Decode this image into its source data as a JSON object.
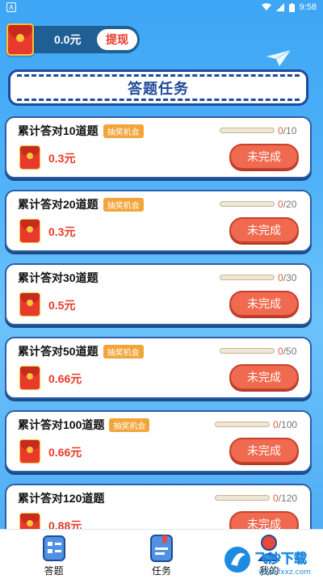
{
  "status": {
    "time": "9:58"
  },
  "wallet": {
    "balance": "0.0元",
    "withdraw_label": "提现"
  },
  "banner": {
    "title": "答题任务"
  },
  "badge_label": "抽奖机会",
  "button_label": "未完成",
  "tasks": [
    {
      "title": "累计答对10道题",
      "reward": "0.3元",
      "current": "0",
      "target": "/10",
      "has_badge": true
    },
    {
      "title": "累计答对20道题",
      "reward": "0.3元",
      "current": "0",
      "target": "/20",
      "has_badge": true
    },
    {
      "title": "累计答对30道题",
      "reward": "0.5元",
      "current": "0",
      "target": "/30",
      "has_badge": false
    },
    {
      "title": "累计答对50道题",
      "reward": "0.66元",
      "current": "0",
      "target": "/50",
      "has_badge": true
    },
    {
      "title": "累计答对100道题",
      "reward": "0.66元",
      "current": "0",
      "target": "/100",
      "has_badge": true
    },
    {
      "title": "累计答对120道题",
      "reward": "0.88元",
      "current": "0",
      "target": "/120",
      "has_badge": false
    }
  ],
  "nav": [
    {
      "label": "答题",
      "icon": "quiz-icon"
    },
    {
      "label": "任务",
      "icon": "task-icon"
    },
    {
      "label": "我的",
      "icon": "profile-icon"
    }
  ],
  "watermark": {
    "text": "飞沙下载",
    "url": "www.fxxz.com"
  }
}
